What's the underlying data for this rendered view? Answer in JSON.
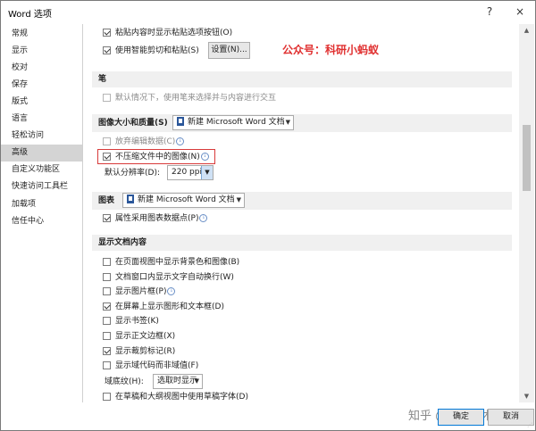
{
  "window": {
    "title": "Word 选项",
    "help": "?",
    "close": "×"
  },
  "sidebar": {
    "items": [
      {
        "label": "常规"
      },
      {
        "label": "显示"
      },
      {
        "label": "校对"
      },
      {
        "label": "保存"
      },
      {
        "label": "版式"
      },
      {
        "label": "语言"
      },
      {
        "label": "轻松访问"
      },
      {
        "label": "高级",
        "active": true
      },
      {
        "label": "自定义功能区"
      },
      {
        "label": "快速访问工具栏"
      },
      {
        "label": "加载项"
      },
      {
        "label": "信任中心"
      }
    ]
  },
  "paste": {
    "show_paste_options": {
      "label": "粘贴内容时显示粘贴选项按钮(O)",
      "checked": true
    },
    "smart_cut_paste": {
      "label": "使用智能剪切和粘贴(S)",
      "checked": true
    },
    "settings_button": "设置(N)..."
  },
  "watermark": "公众号：科研小蚂蚁",
  "pen": {
    "section_title": "笔",
    "default_select": {
      "label": "默认情况下，使用笔来选择并与内容进行交互",
      "checked": false,
      "disabled": true
    }
  },
  "image_size": {
    "section_title": "图像大小和质量(S)",
    "document_select": "新建 Microsoft Word 文档",
    "discard_edit_data": {
      "label": "放弃编辑数据(C)",
      "checked": false,
      "disabled": true
    },
    "no_compress": {
      "label": "不压缩文件中的图像(N)",
      "checked": true
    },
    "resolution_label": "默认分辨率(D):",
    "resolution_value": "220 ppi"
  },
  "chart": {
    "section_title": "图表",
    "document_select": "新建 Microsoft Word 文档",
    "properties_follow": {
      "label": "属性采用图表数据点(P)",
      "checked": true
    }
  },
  "display": {
    "section_title": "显示文档内容",
    "items": [
      {
        "label": "在页面视图中显示背景色和图像(B)",
        "checked": false,
        "info": false
      },
      {
        "label": "文档窗口内显示文字自动换行(W)",
        "checked": false,
        "info": false
      },
      {
        "label": "显示图片框(P)",
        "checked": false,
        "info": true
      },
      {
        "label": "在屏幕上显示图形和文本框(D)",
        "checked": true,
        "info": false
      },
      {
        "label": "显示书签(K)",
        "checked": false,
        "info": false
      },
      {
        "label": "显示正文边框(X)",
        "checked": false,
        "info": false
      },
      {
        "label": "显示裁剪标记(R)",
        "checked": true,
        "info": false
      },
      {
        "label": "显示域代码而非域值(F)",
        "checked": false,
        "info": false
      }
    ],
    "field_shading_label": "域底纹(H):",
    "field_shading_value": "选取时显示",
    "draft_font": {
      "label": "在草稿和大纲视图中使用草稿字体(D)",
      "checked": false
    }
  },
  "footer": {
    "ok": "确定",
    "cancel": "取消",
    "watermark": "知乎 @蚂蚁学术"
  },
  "colors": {
    "accent": "#0078d7",
    "highlight": "#d83a3a",
    "watermark": "#e03030"
  }
}
